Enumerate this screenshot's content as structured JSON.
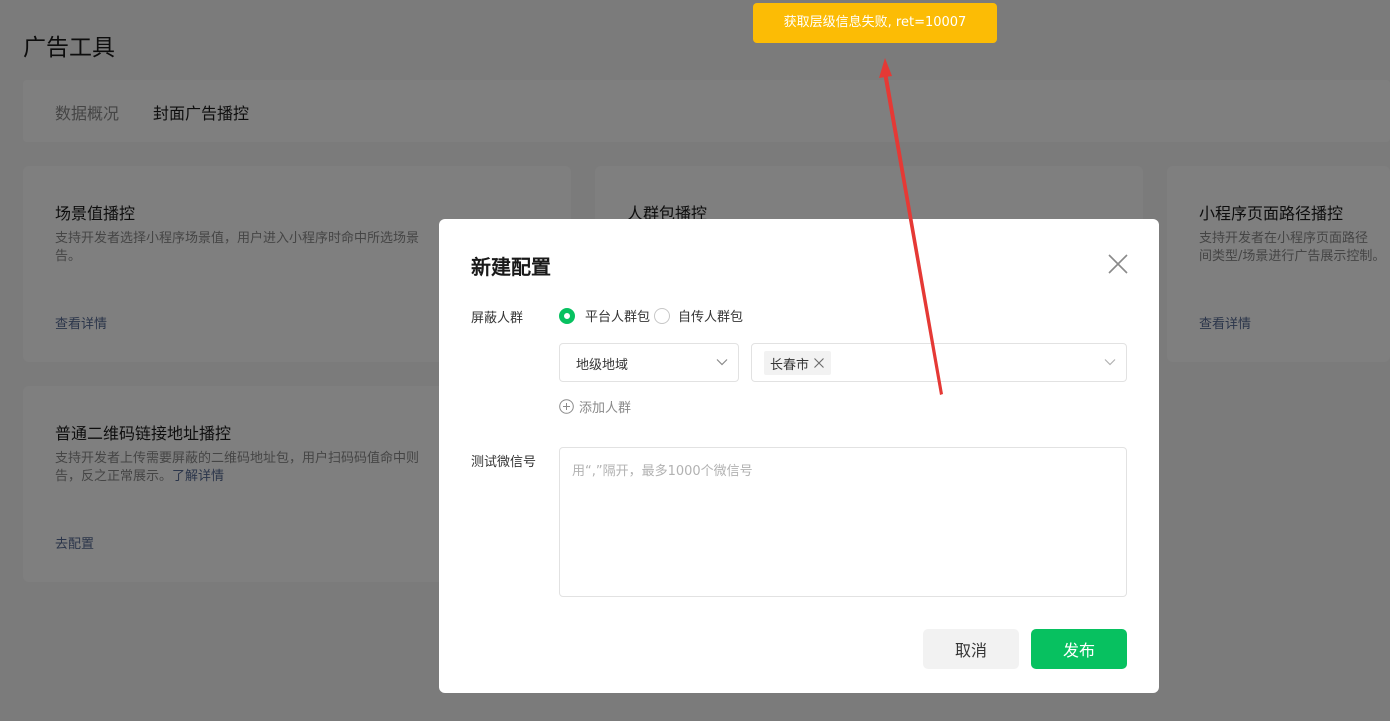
{
  "page": {
    "title": "广告工具",
    "tabs": [
      {
        "label": "数据概况"
      },
      {
        "label": "封面广告播控"
      }
    ]
  },
  "cards": [
    {
      "title": "场景值播控",
      "desc": "支持开发者选择小程序场景值，用户进入小程序时命中所选场景",
      "desc2": "告。",
      "link": "查看详情"
    },
    {
      "title": "人群包播控",
      "desc": "",
      "link": ""
    },
    {
      "title": "小程序页面路径播控",
      "desc": "支持开发者在小程序页面路径",
      "desc2": "间类型/场景进行广告展示控制。",
      "link": "查看详情"
    },
    {
      "title": "普通二维码链接地址播控",
      "desc": "支持开发者上传需要屏蔽的二维码地址包，用户扫码码值命中则",
      "desc2": "告，反之正常展示。",
      "inline_link": "了解详情",
      "link": "去配置"
    }
  ],
  "dialog": {
    "title": "新建配置",
    "crowd_label": "屏蔽人群",
    "radio_options": [
      {
        "label": "平台人群包",
        "checked": true
      },
      {
        "label": "自传人群包",
        "checked": false
      }
    ],
    "region_select": {
      "value": "地级地域"
    },
    "city_select": {
      "tags": [
        "长春市"
      ]
    },
    "add_crowd_label": "添加人群",
    "wechat_label": "测试微信号",
    "wechat_placeholder": "用“,”隔开，最多1000个微信号",
    "cancel_label": "取消",
    "publish_label": "发布"
  },
  "toast": {
    "message": "获取层级信息失败, ret=10007"
  },
  "colors": {
    "primary": "#07c160",
    "toast": "#fcbc05",
    "link": "#576b95",
    "annotation": "#e53935"
  }
}
